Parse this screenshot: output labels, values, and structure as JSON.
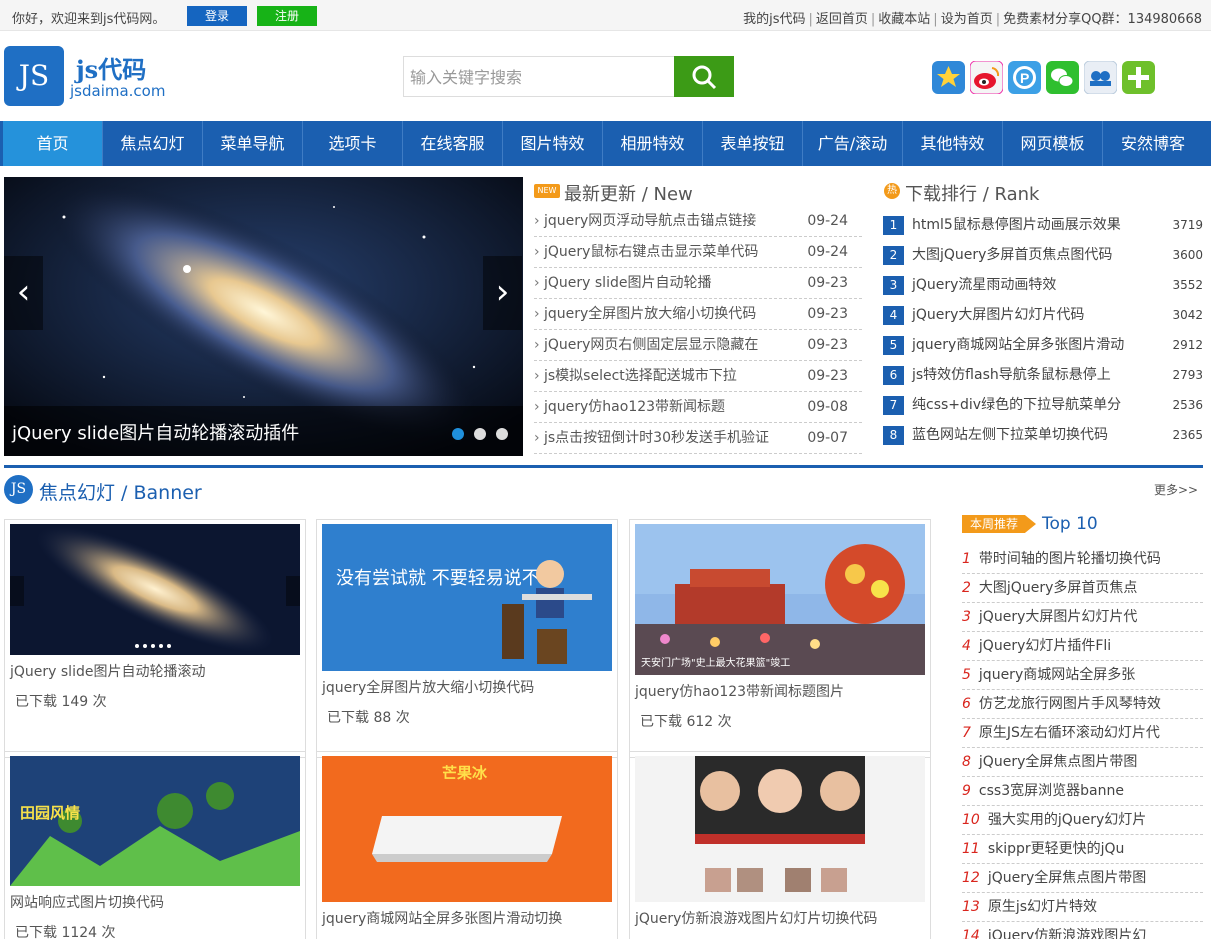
{
  "topbar": {
    "welcome": "你好，欢迎来到js代码网。",
    "login": "登录",
    "register": "注册",
    "links": [
      "我的js代码",
      "返回首页",
      "收藏本站",
      "设为首页",
      "免费素材分享QQ群：134980668"
    ]
  },
  "header": {
    "logo_mark": "JS",
    "logo_cn": "js代码",
    "logo_en": "jsdaima.com",
    "search_placeholder": "输入关键字搜索",
    "share_icons": [
      "qzone-icon",
      "weibo-icon",
      "pengyou-icon",
      "wechat-icon",
      "renren-icon",
      "more-share-icon"
    ]
  },
  "nav": [
    "首页",
    "焦点幻灯",
    "菜单导航",
    "选项卡",
    "在线客服",
    "图片特效",
    "相册特效",
    "表单按钮",
    "广告/滚动",
    "其他特效",
    "网页模板",
    "安然博客"
  ],
  "slider": {
    "caption": "jQuery slide图片自动轮播滚动插件",
    "prev": "‹",
    "next": "›",
    "active_dot": 0,
    "dot_count": 3
  },
  "news": {
    "badge": "NEW",
    "title": "最新更新 / New",
    "items": [
      {
        "title": "jquery网页浮动导航点击锚点链接",
        "date": "09-24"
      },
      {
        "title": "jQuery鼠标右键点击显示菜单代码",
        "date": "09-24"
      },
      {
        "title": "jQuery slide图片自动轮播",
        "date": "09-23"
      },
      {
        "title": "jquery全屏图片放大缩小切换代码",
        "date": "09-23"
      },
      {
        "title": "jQuery网页右侧固定层显示隐藏在",
        "date": "09-23"
      },
      {
        "title": "js模拟select选择配送城市下拉",
        "date": "09-23"
      },
      {
        "title": "jquery仿hao123带新闻标题",
        "date": "09-08"
      },
      {
        "title": "js点击按钮倒计时30秒发送手机验证",
        "date": "09-07"
      }
    ]
  },
  "rank": {
    "badge": "热",
    "title": "下载排行 / Rank",
    "items": [
      {
        "n": "1",
        "title": "html5鼠标悬停图片动画展示效果",
        "count": "3719"
      },
      {
        "n": "2",
        "title": "大图jQuery多屏首页焦点图代码",
        "count": "3600"
      },
      {
        "n": "3",
        "title": "jQuery流星雨动画特效",
        "count": "3552"
      },
      {
        "n": "4",
        "title": "jQuery大屏图片幻灯片代码",
        "count": "3042"
      },
      {
        "n": "5",
        "title": "jquery商城网站全屏多张图片滑动",
        "count": "2912"
      },
      {
        "n": "6",
        "title": "js特效仿flash导航条鼠标悬停上",
        "count": "2793"
      },
      {
        "n": "7",
        "title": "纯css+div绿色的下拉导航菜单分",
        "count": "2536"
      },
      {
        "n": "8",
        "title": "蓝色网站左侧下拉菜单切换代码",
        "count": "2365"
      }
    ]
  },
  "banner_section": {
    "badge": "JS",
    "title": "焦点幻灯 / Banner",
    "more": "更多>>",
    "cards": [
      {
        "title": "jQuery slide图片自动轮播滚动",
        "downloads": "已下载 149 次",
        "img_text": ""
      },
      {
        "title": "jquery全屏图片放大缩小切换代码",
        "downloads": "已下载 88 次",
        "img_text": "没有尝试就 不要轻易说不行"
      },
      {
        "title": "jquery仿hao123带新闻标题图片",
        "downloads": "已下载 612 次",
        "img_text": "天安门广场\"史上最大花果篮\"竣工"
      },
      {
        "title": "网站响应式图片切换代码",
        "downloads": "已下载 1124 次",
        "img_text": "田园风情"
      },
      {
        "title": "jquery商城网站全屏多张图片滑动切换",
        "downloads": "",
        "img_text": "芒果冰"
      },
      {
        "title": "jQuery仿新浪游戏图片幻灯片切换代码",
        "downloads": "",
        "img_text": ""
      }
    ]
  },
  "top10": {
    "tag": "本周推荐",
    "title": "Top 10",
    "items": [
      {
        "n": "1",
        "title": "带时间轴的图片轮播切换代码"
      },
      {
        "n": "2",
        "title": "大图jQuery多屏首页焦点"
      },
      {
        "n": "3",
        "title": "jQuery大屏图片幻灯片代"
      },
      {
        "n": "4",
        "title": "jQuery幻灯片插件Fli"
      },
      {
        "n": "5",
        "title": "jquery商城网站全屏多张"
      },
      {
        "n": "6",
        "title": "仿艺龙旅行网图片手风琴特效"
      },
      {
        "n": "7",
        "title": "原生JS左右循环滚动幻灯片代"
      },
      {
        "n": "8",
        "title": "jQuery全屏焦点图片带图"
      },
      {
        "n": "9",
        "title": "css3宽屏浏览器banne"
      },
      {
        "n": "10",
        "title": "强大实用的jQuery幻灯片"
      },
      {
        "n": "11",
        "title": "skippr更轻更快的jQu"
      },
      {
        "n": "12",
        "title": "jQuery全屏焦点图片带图"
      },
      {
        "n": "13",
        "title": "原生js幻灯片特效"
      },
      {
        "n": "14",
        "title": "jQuery仿新浪游戏图片幻"
      }
    ]
  },
  "colors": {
    "primary": "#1b5fb0",
    "nav_active": "#2592db",
    "search": "#3c9b16",
    "register": "#17b317",
    "rank_num": "#d9251d"
  }
}
